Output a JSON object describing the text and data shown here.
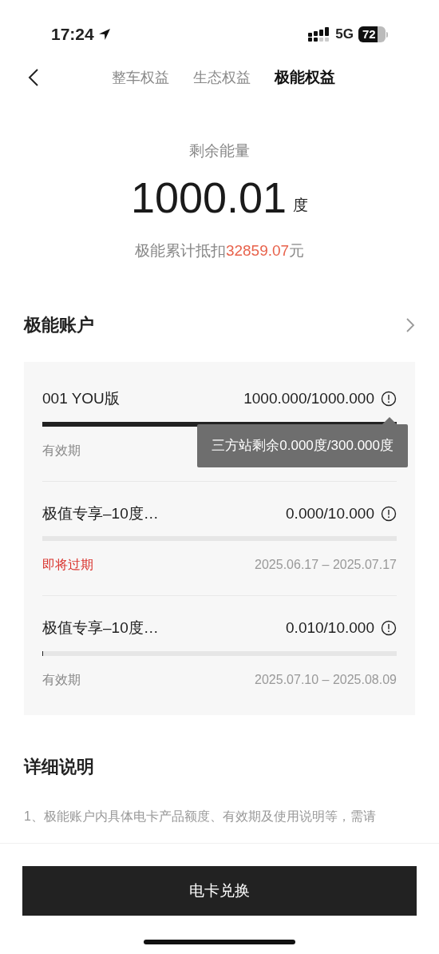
{
  "status_bar": {
    "time": "17:24",
    "network": "5G",
    "battery": "72"
  },
  "tabs": [
    {
      "label": "整车权益",
      "selected": false
    },
    {
      "label": "生态权益",
      "selected": false
    },
    {
      "label": "极能权益",
      "selected": true
    }
  ],
  "summary": {
    "label": "剩余能量",
    "value": "1000.01",
    "unit": "度",
    "deduction_label": "极能累计抵扣",
    "deduction_value": "32859.07",
    "deduction_unit": "元"
  },
  "account": {
    "title": "极能账户",
    "items": [
      {
        "name": "001 YOU版",
        "amount": "1000.000/1000.000",
        "level": 1,
        "status": "有效期",
        "expiring": false,
        "tooltip": "三方站剩余0.000度/300.000度"
      },
      {
        "name": "极值专享–10度…",
        "amount": "0.000/10.000",
        "status": "即将过期",
        "expiring": true,
        "dates": "2025.06.17 – 2025.07.17"
      },
      {
        "name": "极值专享–10度…",
        "amount": "0.010/10.000",
        "level": 0.001,
        "status": "有效期",
        "expiring": false,
        "dates": "2025.07.10 – 2025.08.09"
      }
    ]
  },
  "details": {
    "title": "详细说明",
    "text": "1、极能账户内具体电卡产品额度、有效期及使用说明等，需请"
  },
  "button": "电卡兑换"
}
